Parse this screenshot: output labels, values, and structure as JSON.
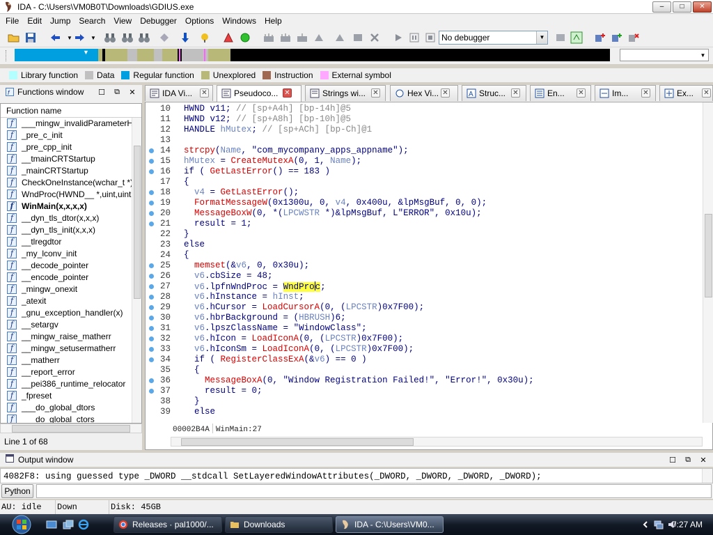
{
  "window": {
    "title": "IDA - C:\\Users\\VM0B0T\\Downloads\\GDIUS.exe",
    "min": "–",
    "max": "□",
    "close": "✕"
  },
  "menu": [
    "File",
    "Edit",
    "Jump",
    "Search",
    "View",
    "Debugger",
    "Options",
    "Windows",
    "Help"
  ],
  "toolbar": {
    "debugger_select": "No debugger"
  },
  "legend": [
    {
      "label": "Library function",
      "color": "#b3ffff"
    },
    {
      "label": "Data",
      "color": "#c0c0c0"
    },
    {
      "label": "Regular function",
      "color": "#00a0e0"
    },
    {
      "label": "Unexplored",
      "color": "#b8b878"
    },
    {
      "label": "Instruction",
      "color": "#a06850"
    },
    {
      "label": "External symbol",
      "color": "#ffa8ff"
    }
  ],
  "functions": {
    "title": "Functions window",
    "header": "Function name",
    "items": [
      {
        "name": "___mingw_invalidParameterH",
        "bold": false
      },
      {
        "name": "_pre_c_init",
        "bold": false
      },
      {
        "name": "_pre_cpp_init",
        "bold": false
      },
      {
        "name": "__tmainCRTStartup",
        "bold": false
      },
      {
        "name": "_mainCRTStartup",
        "bold": false
      },
      {
        "name": "CheckOneInstance(wchar_t *)",
        "bold": false
      },
      {
        "name": "WndProc(HWND__ *,uint,uint",
        "bold": false
      },
      {
        "name": "WinMain(x,x,x,x)",
        "bold": true
      },
      {
        "name": "__dyn_tls_dtor(x,x,x)",
        "bold": false
      },
      {
        "name": "__dyn_tls_init(x,x,x)",
        "bold": false
      },
      {
        "name": "__tlregdtor",
        "bold": false
      },
      {
        "name": "_my_lconv_init",
        "bold": false
      },
      {
        "name": "__decode_pointer",
        "bold": false
      },
      {
        "name": "__encode_pointer",
        "bold": false
      },
      {
        "name": "_mingw_onexit",
        "bold": false
      },
      {
        "name": "_atexit",
        "bold": false
      },
      {
        "name": "_gnu_exception_handler(x)",
        "bold": false
      },
      {
        "name": "__setargv",
        "bold": false
      },
      {
        "name": "__mingw_raise_matherr",
        "bold": false
      },
      {
        "name": "__mingw_setusermatherr",
        "bold": false
      },
      {
        "name": "__matherr",
        "bold": false
      },
      {
        "name": "__report_error",
        "bold": false
      },
      {
        "name": "__pei386_runtime_relocator",
        "bold": false
      },
      {
        "name": "_fpreset",
        "bold": false
      },
      {
        "name": "___do_global_dtors",
        "bold": false
      },
      {
        "name": "___do_global_ctors",
        "bold": false
      }
    ],
    "status": "Line 1 of 68"
  },
  "tabs": [
    {
      "label": "IDA Vi...",
      "active": false
    },
    {
      "label": "Pseudoco...",
      "active": true
    },
    {
      "label": "Strings wi...",
      "active": false
    },
    {
      "label": "Hex Vi...",
      "active": false
    },
    {
      "label": "Struc...",
      "active": false
    },
    {
      "label": "En...",
      "active": false
    },
    {
      "label": "Im...",
      "active": false
    },
    {
      "label": "Ex...",
      "active": false
    }
  ],
  "code": {
    "lines": [
      {
        "n": "10",
        "dot": false,
        "text": "HWND v11; // [sp+A4h] [bp-14h]@5"
      },
      {
        "n": "11",
        "dot": false,
        "text": "HWND v12; // [sp+A8h] [bp-10h]@5"
      },
      {
        "n": "12",
        "dot": false,
        "text": "HANDLE hMutex; // [sp+ACh] [bp-Ch]@1"
      },
      {
        "n": "13",
        "dot": false,
        "text": ""
      },
      {
        "n": "14",
        "dot": true,
        "text": "strcpy(Name, \"com_mycompany_apps_appname\");"
      },
      {
        "n": "15",
        "dot": true,
        "text": "hMutex = CreateMutexA(0, 1, Name);"
      },
      {
        "n": "16",
        "dot": true,
        "text": "if ( GetLastError() == 183 )"
      },
      {
        "n": "17",
        "dot": false,
        "text": "{"
      },
      {
        "n": "18",
        "dot": true,
        "text": "  v4 = GetLastError();"
      },
      {
        "n": "19",
        "dot": true,
        "text": "  FormatMessageW(0x1300u, 0, v4, 0x400u, &lpMsgBuf, 0, 0);"
      },
      {
        "n": "20",
        "dot": true,
        "text": "  MessageBoxW(0, *(LPCWSTR *)&lpMsgBuf, L\"ERROR\", 0x10u);"
      },
      {
        "n": "21",
        "dot": true,
        "text": "  result = 1;"
      },
      {
        "n": "22",
        "dot": false,
        "text": "}"
      },
      {
        "n": "23",
        "dot": false,
        "text": "else"
      },
      {
        "n": "24",
        "dot": false,
        "text": "{"
      },
      {
        "n": "25",
        "dot": true,
        "text": "  memset(&v6, 0, 0x30u);"
      },
      {
        "n": "26",
        "dot": true,
        "text": "  v6.cbSize = 48;"
      },
      {
        "n": "27",
        "dot": true,
        "text": "  v6.lpfnWndProc = WndProc;"
      },
      {
        "n": "28",
        "dot": true,
        "text": "  v6.hInstance = hInst;"
      },
      {
        "n": "29",
        "dot": true,
        "text": "  v6.hCursor = LoadCursorA(0, (LPCSTR)0x7F00);"
      },
      {
        "n": "30",
        "dot": true,
        "text": "  v6.hbrBackground = (HBRUSH)6;"
      },
      {
        "n": "31",
        "dot": true,
        "text": "  v6.lpszClassName = \"WindowClass\";"
      },
      {
        "n": "32",
        "dot": true,
        "text": "  v6.hIcon = LoadIconA(0, (LPCSTR)0x7F00);"
      },
      {
        "n": "33",
        "dot": true,
        "text": "  v6.hIconSm = LoadIconA(0, (LPCSTR)0x7F00);"
      },
      {
        "n": "34",
        "dot": true,
        "text": "  if ( RegisterClassExA(&v6) == 0 )"
      },
      {
        "n": "35",
        "dot": false,
        "text": "  {"
      },
      {
        "n": "36",
        "dot": true,
        "text": "    MessageBoxA(0, \"Window Registration Failed!\", \"Error!\", 0x30u);"
      },
      {
        "n": "37",
        "dot": true,
        "text": "    result = 0;"
      },
      {
        "n": "38",
        "dot": false,
        "text": "  }"
      },
      {
        "n": "39",
        "dot": false,
        "text": "  else"
      }
    ],
    "status_address": "00002B4A",
    "status_location": "WinMain:27"
  },
  "output": {
    "title": "Output window",
    "line": "4082F8: using guessed type _DWORD __stdcall SetLayeredWindowAttributes(_DWORD, _DWORD, _DWORD, _DWORD);",
    "python_button": "Python"
  },
  "ida_status": {
    "au": "AU:  idle",
    "dir": "Down",
    "disk": "Disk: 45GB"
  },
  "taskbar": {
    "buttons": [
      {
        "label": "Releases · pal1000/...",
        "active": false
      },
      {
        "label": "Downloads",
        "active": false
      },
      {
        "label": "IDA - C:\\Users\\VM0...",
        "active": true
      }
    ],
    "clock": "7:27 AM"
  }
}
